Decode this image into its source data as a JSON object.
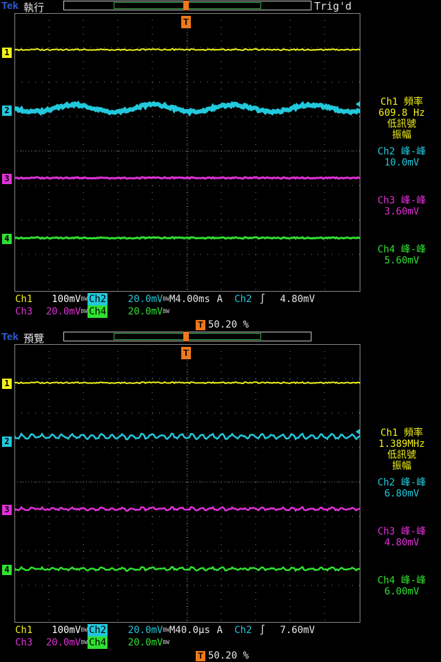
{
  "colors": {
    "ch1": "#f2f218",
    "ch2": "#22c8dc",
    "ch3": "#e030d8",
    "ch4": "#30e030",
    "accent": "#f07818",
    "brand": "#2f5fd0",
    "grid": "#8a8a8a"
  },
  "panels": [
    {
      "brand": "Tek",
      "mode": "執行",
      "trig_status": "Trig'd",
      "trig_marker": "T",
      "channels": [
        "1",
        "2",
        "3",
        "4"
      ],
      "measurements": [
        {
          "lines": [
            "Ch1 頻率",
            "609.8 Hz",
            "低訊號",
            "振幅"
          ]
        },
        {
          "lines": [
            "Ch2 峰-峰",
            "10.0mV"
          ]
        },
        {
          "lines": [
            "Ch3 峰-峰",
            "3.60mV"
          ]
        },
        {
          "lines": [
            "Ch4 峰-峰",
            "5.60mV"
          ]
        }
      ],
      "status": {
        "ch1_label": "Ch1",
        "ch1_scale": "100mV",
        "ch2_label": "Ch2",
        "ch2_scale": "20.0mV",
        "ch3_label": "Ch3",
        "ch3_scale": "20.0mV",
        "ch4_label": "Ch4",
        "ch4_scale": "20.0mV",
        "bw": "BW",
        "timebase": "M4.00ms",
        "acq": "A",
        "trig_src": "Ch2",
        "trig_slope": "∫",
        "trig_level": "4.80mV",
        "trig_pos_marker": "T",
        "trig_pos": "50.20 %"
      }
    },
    {
      "brand": "Tek",
      "mode": "預覽",
      "trig_status": "",
      "trig_marker": "T",
      "channels": [
        "1",
        "2",
        "3",
        "4"
      ],
      "measurements": [
        {
          "lines": [
            "Ch1 頻率",
            "1.389MHz",
            "低訊號",
            "振幅"
          ]
        },
        {
          "lines": [
            "Ch2 峰-峰",
            "6.80mV"
          ]
        },
        {
          "lines": [
            "Ch3 峰-峰",
            "4.80mV"
          ]
        },
        {
          "lines": [
            "Ch4 峰-峰",
            "6.00mV"
          ]
        }
      ],
      "status": {
        "ch1_label": "Ch1",
        "ch1_scale": "100mV",
        "ch2_label": "Ch2",
        "ch2_scale": "20.0mV",
        "ch3_label": "Ch3",
        "ch3_scale": "20.0mV",
        "ch4_label": "Ch4",
        "ch4_scale": "20.0mV",
        "bw": "BW",
        "timebase": "M40.0µs",
        "acq": "A",
        "trig_src": "Ch2",
        "trig_slope": "∫",
        "trig_level": "7.60mV",
        "trig_pos_marker": "T",
        "trig_pos": "50.20 %"
      }
    }
  ]
}
